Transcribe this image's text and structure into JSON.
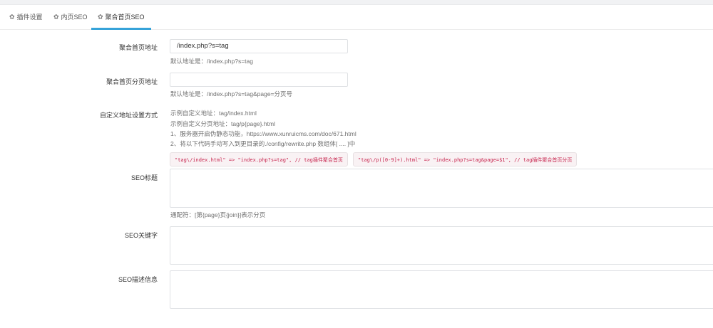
{
  "tabs": [
    {
      "label": "插件设置",
      "icon": "gear-icon"
    },
    {
      "label": "内页SEO",
      "icon": "gear-icon"
    },
    {
      "label": "聚合首页SEO",
      "icon": "gear-icon",
      "active": true
    }
  ],
  "form": {
    "home_url": {
      "label": "聚合首页地址",
      "value": "/index.php?s=tag",
      "help": "默认地址是：/index.php?s=tag"
    },
    "page_url": {
      "label": "聚合首页分页地址",
      "value": "",
      "help": "默认地址是：/index.php?s=tag&page=分页号"
    },
    "custom_url": {
      "label": "自定义地址设置方式",
      "lines": [
        "示例自定义地址：tag/index.html",
        "示例自定义分页地址：tag/p{page}.html",
        "1、服务器开启伪静态功能，https://www.xunruicms.com/doc/671.html",
        "2、将以下代码手动写入到更目录的./config/rewrite.php 数组体[ .... ]中"
      ],
      "code": [
        "\"tag\\/index.html\" => \"index.php?s=tag\", // tag插件聚合首页",
        "\"tag\\/p([0-9]+).html\" => \"index.php?s=tag&page=$1\", // tag插件聚合首页分页"
      ]
    },
    "seo_title": {
      "label": "SEO标题",
      "value": "",
      "help": "通配符：[第{page}页{join}]表示分页"
    },
    "seo_keywords": {
      "label": "SEO关键字",
      "value": ""
    },
    "seo_description": {
      "label": "SEO描述信息",
      "value": ""
    }
  },
  "colors": {
    "accent": "#36a3d9",
    "code_text": "#c7254e",
    "code_bg": "#f9f2f4"
  }
}
